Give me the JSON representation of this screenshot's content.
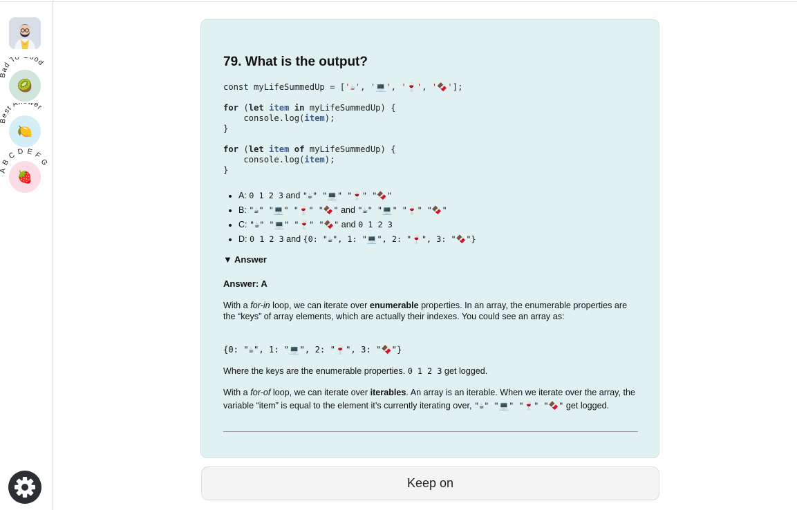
{
  "sidebar": {
    "nav": [
      {
        "label": "Bad To Good",
        "icon": "kiwi-icon",
        "glyph": "🥝",
        "bg": "#cfe5da"
      },
      {
        "label": "Best Answer",
        "icon": "lemon-icon",
        "glyph": "🍋",
        "bg": "#d3eef6"
      },
      {
        "label": "A B C D E F G",
        "icon": "strawberry-icon",
        "glyph": "🍓",
        "bg": "#fbdbe4"
      }
    ]
  },
  "question": {
    "title": "79. What is the output?",
    "code_line1_a": "const myLifeSummedUp = [",
    "code_line1_items": [
      "'☕'",
      "'💻'",
      "'🍷'",
      "'🍫'"
    ],
    "code_line1_b": "];",
    "options": [
      {
        "prefix": "A: ",
        "mono1": "0 1 2 3",
        "mid": " and ",
        "mono2": "\"☕\" \"💻\" \"🍷\" \"🍫\""
      },
      {
        "prefix": "B: ",
        "mono1": "\"☕\" \"💻\" \"🍷\" \"🍫\"",
        "mid": " and ",
        "mono2": "\"☕\" \"💻\" \"🍷\" \"🍫\""
      },
      {
        "prefix": "C: ",
        "mono1": "\"☕\" \"💻\" \"🍷\" \"🍫\"",
        "mid": " and ",
        "mono2": "0 1 2 3"
      },
      {
        "prefix": "D: ",
        "mono1": "0 1 2 3",
        "mid": " and ",
        "mono2": "{0: \"☕\", 1: \"💻\", 2: \"🍷\", 3: \"🍫\"}"
      }
    ]
  },
  "answer": {
    "toggle": "▼ Answer",
    "heading": "Answer: A",
    "p1_a": "With a ",
    "p1_em": "for-in",
    "p1_b": " loop, we can iterate over ",
    "p1_strong": "enumerable",
    "p1_c": " properties. In an array, the enumerable properties are the “keys” of array elements, which are actually their indexes. You could see an array as:",
    "obj": "{0: \"☕\", 1: \"💻\", 2: \"🍷\", 3: \"🍫\"}",
    "p2_a": "Where the keys are the enumerable properties. ",
    "p2_mono": "0 1 2 3",
    "p2_b": " get logged.",
    "p3_a": "With a ",
    "p3_em": "for-of",
    "p3_b": " loop, we can iterate over ",
    "p3_strong": "iterables",
    "p3_c": ". An array is an iterable. When we iterate over the array, the variable “item” is equal to the element it’s currently iterating over, ",
    "p3_mono": "\"☕\" \"💻\" \"🍷\" \"🍫\"",
    "p3_d": " get logged."
  },
  "footer": {
    "keep_on": "Keep on"
  }
}
